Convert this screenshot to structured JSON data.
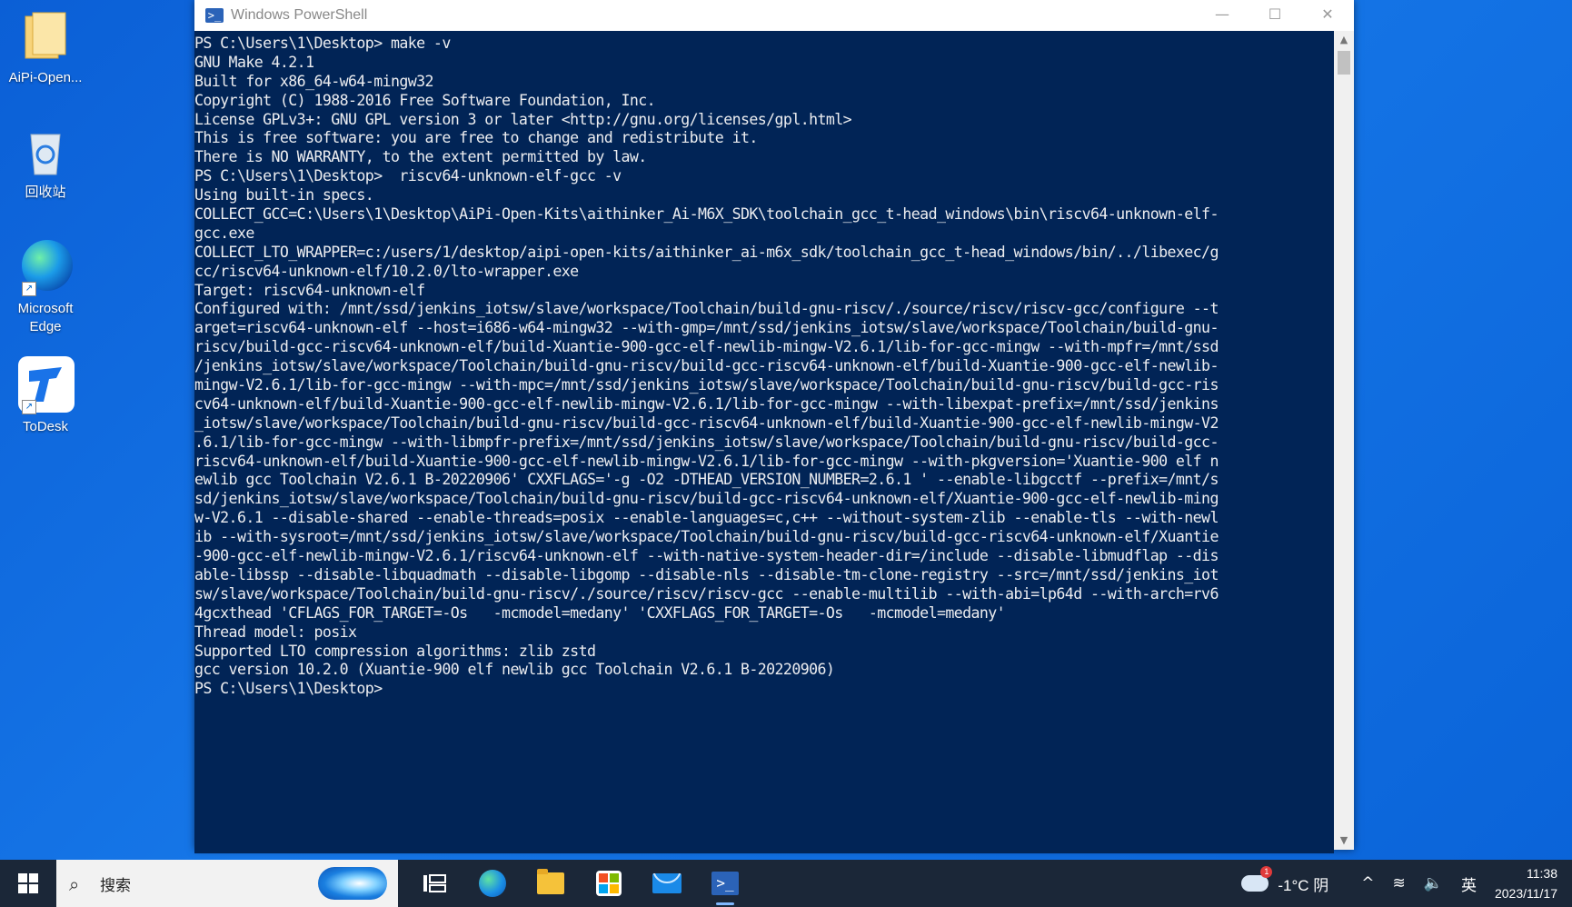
{
  "desktop": {
    "icons": [
      {
        "label": "AiPi-Open..."
      },
      {
        "label": "回收站"
      },
      {
        "label": "Microsoft Edge"
      },
      {
        "label": "ToDesk"
      }
    ]
  },
  "window": {
    "title": "Windows PowerShell",
    "controls": {
      "minimize": "—",
      "maximize": "☐",
      "close": "✕"
    }
  },
  "console": {
    "lines": [
      "PS C:\\Users\\1\\Desktop> make -v",
      "GNU Make 4.2.1",
      "Built for x86_64-w64-mingw32",
      "Copyright (C) 1988-2016 Free Software Foundation, Inc.",
      "License GPLv3+: GNU GPL version 3 or later <http://gnu.org/licenses/gpl.html>",
      "This is free software: you are free to change and redistribute it.",
      "There is NO WARRANTY, to the extent permitted by law.",
      "PS C:\\Users\\1\\Desktop>  riscv64-unknown-elf-gcc -v",
      "Using built-in specs.",
      "COLLECT_GCC=C:\\Users\\1\\Desktop\\AiPi-Open-Kits\\aithinker_Ai-M6X_SDK\\toolchain_gcc_t-head_windows\\bin\\riscv64-unknown-elf-",
      "gcc.exe",
      "COLLECT_LTO_WRAPPER=c:/users/1/desktop/aipi-open-kits/aithinker_ai-m6x_sdk/toolchain_gcc_t-head_windows/bin/../libexec/g",
      "cc/riscv64-unknown-elf/10.2.0/lto-wrapper.exe",
      "Target: riscv64-unknown-elf",
      "Configured with: /mnt/ssd/jenkins_iotsw/slave/workspace/Toolchain/build-gnu-riscv/./source/riscv/riscv-gcc/configure --t",
      "arget=riscv64-unknown-elf --host=i686-w64-mingw32 --with-gmp=/mnt/ssd/jenkins_iotsw/slave/workspace/Toolchain/build-gnu-",
      "riscv/build-gcc-riscv64-unknown-elf/build-Xuantie-900-gcc-elf-newlib-mingw-V2.6.1/lib-for-gcc-mingw --with-mpfr=/mnt/ssd",
      "/jenkins_iotsw/slave/workspace/Toolchain/build-gnu-riscv/build-gcc-riscv64-unknown-elf/build-Xuantie-900-gcc-elf-newlib-",
      "mingw-V2.6.1/lib-for-gcc-mingw --with-mpc=/mnt/ssd/jenkins_iotsw/slave/workspace/Toolchain/build-gnu-riscv/build-gcc-ris",
      "cv64-unknown-elf/build-Xuantie-900-gcc-elf-newlib-mingw-V2.6.1/lib-for-gcc-mingw --with-libexpat-prefix=/mnt/ssd/jenkins",
      "_iotsw/slave/workspace/Toolchain/build-gnu-riscv/build-gcc-riscv64-unknown-elf/build-Xuantie-900-gcc-elf-newlib-mingw-V2",
      ".6.1/lib-for-gcc-mingw --with-libmpfr-prefix=/mnt/ssd/jenkins_iotsw/slave/workspace/Toolchain/build-gnu-riscv/build-gcc-",
      "riscv64-unknown-elf/build-Xuantie-900-gcc-elf-newlib-mingw-V2.6.1/lib-for-gcc-mingw --with-pkgversion='Xuantie-900 elf n",
      "ewlib gcc Toolchain V2.6.1 B-20220906' CXXFLAGS='-g -O2 -DTHEAD_VERSION_NUMBER=2.6.1 ' --enable-libgcctf --prefix=/mnt/s",
      "sd/jenkins_iotsw/slave/workspace/Toolchain/build-gnu-riscv/build-gcc-riscv64-unknown-elf/Xuantie-900-gcc-elf-newlib-ming",
      "w-V2.6.1 --disable-shared --enable-threads=posix --enable-languages=c,c++ --without-system-zlib --enable-tls --with-newl",
      "ib --with-sysroot=/mnt/ssd/jenkins_iotsw/slave/workspace/Toolchain/build-gnu-riscv/build-gcc-riscv64-unknown-elf/Xuantie",
      "-900-gcc-elf-newlib-mingw-V2.6.1/riscv64-unknown-elf --with-native-system-header-dir=/include --disable-libmudflap --dis",
      "able-libssp --disable-libquadmath --disable-libgomp --disable-nls --disable-tm-clone-registry --src=/mnt/ssd/jenkins_iot",
      "sw/slave/workspace/Toolchain/build-gnu-riscv/./source/riscv/riscv-gcc --enable-multilib --with-abi=lp64d --with-arch=rv6",
      "4gcxthead 'CFLAGS_FOR_TARGET=-Os   -mcmodel=medany' 'CXXFLAGS_FOR_TARGET=-Os   -mcmodel=medany'",
      "Thread model: posix",
      "Supported LTO compression algorithms: zlib zstd",
      "gcc version 10.2.0 (Xuantie-900 elf newlib gcc Toolchain V2.6.1 B-20220906)",
      "PS C:\\Users\\1\\Desktop>"
    ]
  },
  "taskbar": {
    "search_label": "搜索",
    "weather": "-1°C 阴",
    "weather_badge": "1",
    "ime": "英",
    "time": "11:38",
    "date": "2023/11/17"
  },
  "colors": {
    "console_bg": "#012456",
    "console_fg": "#ecedf0",
    "taskbar_bg": "#1b2738",
    "desktop_bg": "#0b5fd6"
  }
}
